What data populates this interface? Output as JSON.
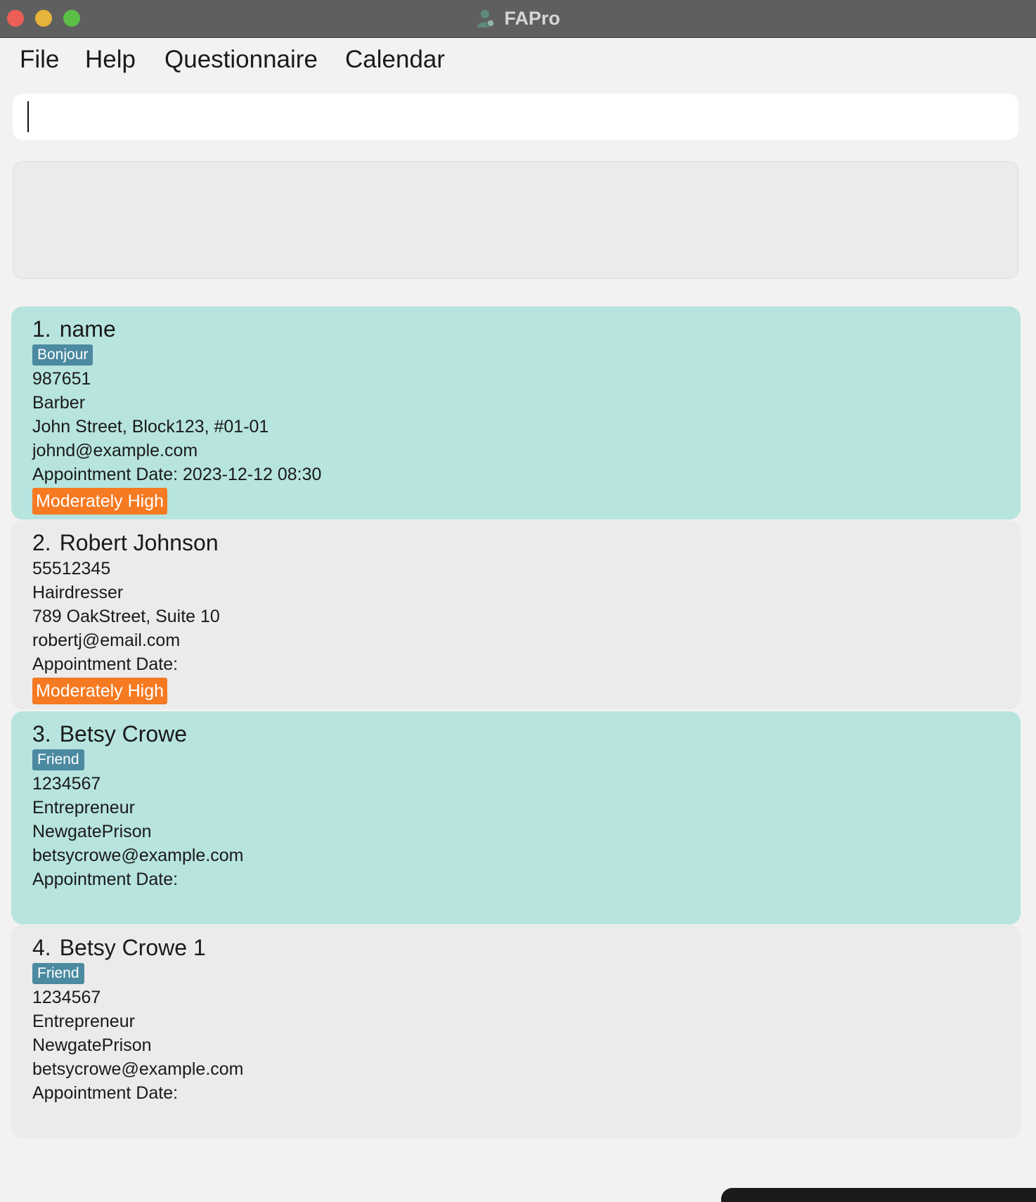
{
  "window": {
    "title": "FAPro",
    "icon": "person-icon"
  },
  "menu": {
    "file": "File",
    "help": "Help",
    "questionnaire": "Questionnaire",
    "calendar": "Calendar"
  },
  "command": {
    "value": "",
    "placeholder": ""
  },
  "result": {
    "text": ""
  },
  "clients": [
    {
      "index": "1.",
      "name": "name",
      "tag": "Bonjour",
      "phone": "987651",
      "occupation": "Barber",
      "address": "John Street, Block123, #01-01",
      "email": "johnd@example.com",
      "appointment": "Appointment Date: 2023-12-12 08:30",
      "risk": "Moderately High"
    },
    {
      "index": "2.",
      "name": "Robert Johnson",
      "tag": "",
      "phone": "55512345",
      "occupation": "Hairdresser",
      "address": "789 OakStreet, Suite 10",
      "email": "robertj@email.com",
      "appointment": "Appointment Date:",
      "risk": "Moderately High"
    },
    {
      "index": "3.",
      "name": "Betsy Crowe",
      "tag": "Friend",
      "phone": "1234567",
      "occupation": "Entrepreneur",
      "address": "NewgatePrison",
      "email": "betsycrowe@example.com",
      "appointment": "Appointment Date:",
      "risk": ""
    },
    {
      "index": "4.",
      "name": "Betsy Crowe 1",
      "tag": "Friend",
      "phone": "1234567",
      "occupation": "Entrepreneur",
      "address": "NewgatePrison",
      "email": "betsycrowe@example.com",
      "appointment": "Appointment Date:",
      "risk": ""
    }
  ],
  "colors": {
    "selected_card": "#b7e4de",
    "card": "#ebebeb",
    "tag": "#4b8aa0",
    "risk_moderately_high": "#f57a21"
  }
}
